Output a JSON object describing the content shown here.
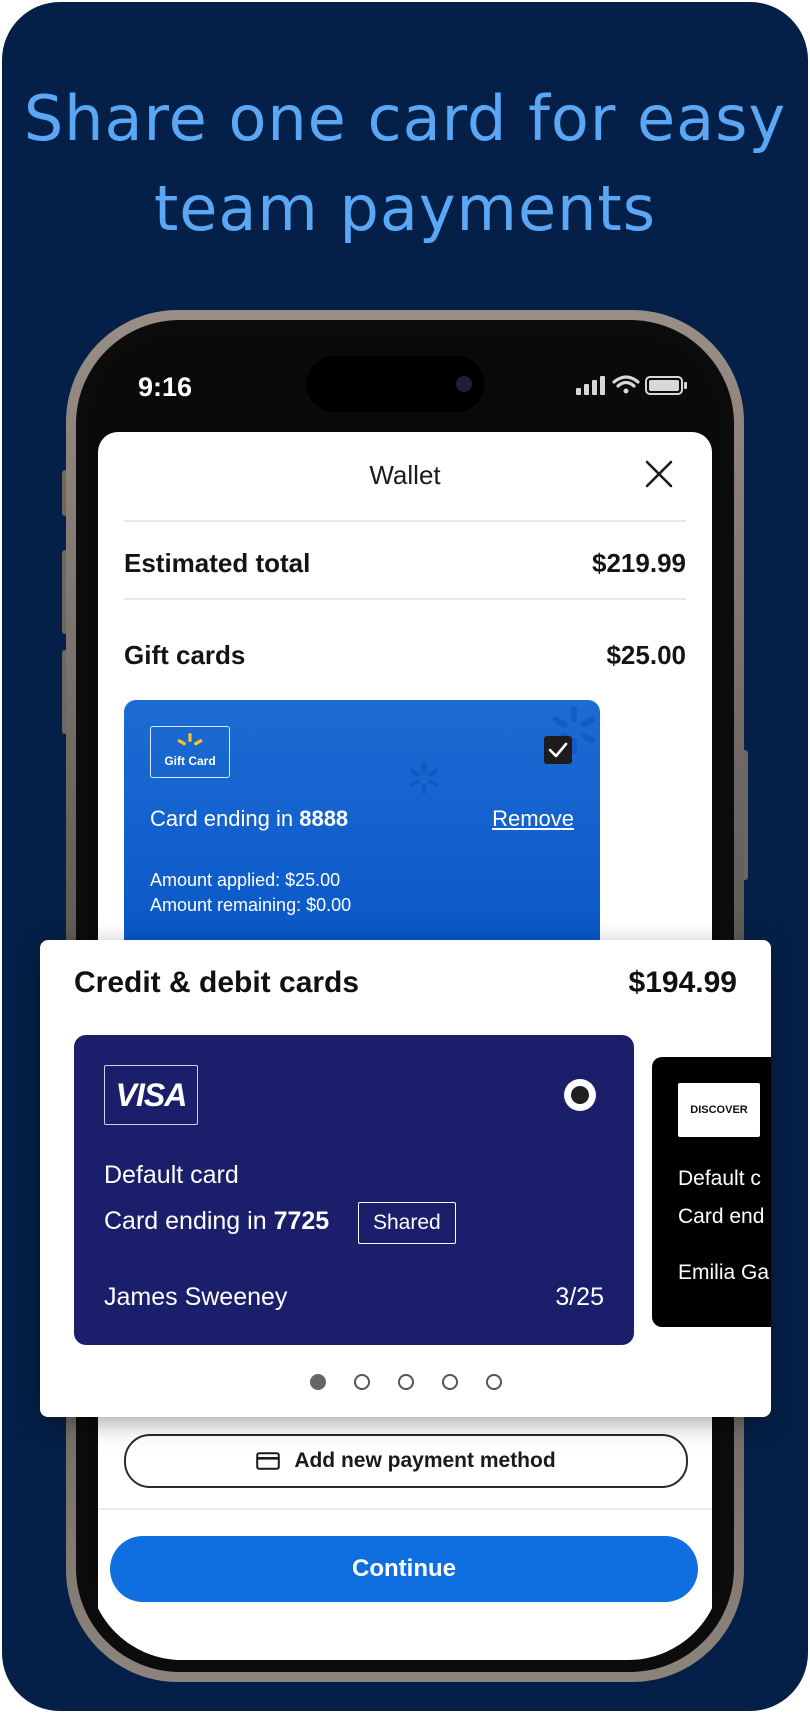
{
  "headline": {
    "line1": "Share one card for easy",
    "line2": "team payments"
  },
  "status_bar": {
    "time": "9:16"
  },
  "wallet": {
    "title": "Wallet",
    "estimated_total_label": "Estimated total",
    "estimated_total_value": "$219.99",
    "gift_cards_label": "Gift cards",
    "gift_cards_value": "$25.00",
    "gift_card": {
      "badge_label": "Gift Card",
      "ending_prefix": "Card ending in ",
      "ending_number": "8888",
      "remove_label": "Remove",
      "amount_applied": "Amount applied: $25.00",
      "amount_remaining": "Amount remaining: $0.00",
      "checked": true
    },
    "add_payment_label": "Add new payment method",
    "continue_label": "Continue"
  },
  "credit_section": {
    "title": "Credit & debit cards",
    "total": "$194.99",
    "cards": [
      {
        "brand": "VISA",
        "default_label": "Default card",
        "ending_prefix": "Card ending in ",
        "ending_number": "7725",
        "shared_label": "Shared",
        "holder": "James Sweeney",
        "expiry": "3/25",
        "color": "#1b1f6b"
      },
      {
        "brand": "DISCOVER",
        "default_label": "Default c",
        "ending_prefix": "Card end",
        "holder": "Emilia Ga",
        "color": "#000000"
      }
    ],
    "pagination": {
      "total": 5,
      "active": 1
    }
  },
  "colors": {
    "background": "#052048",
    "headline": "#5aa8f5",
    "gift_card": "#0a58c8",
    "continue_button": "#0f6fe0",
    "gift_icon_yellow": "#ffc220"
  }
}
